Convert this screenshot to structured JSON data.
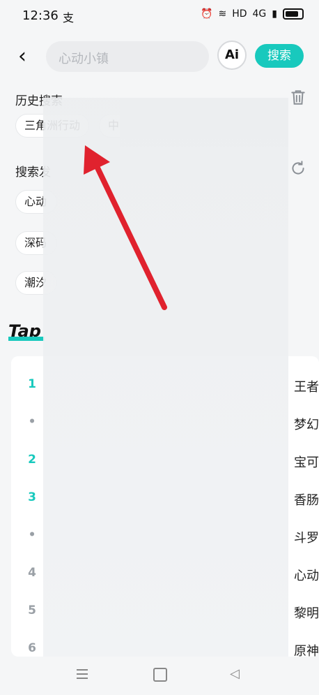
{
  "status_bar": {
    "time": "12:36",
    "app_icon_text": "支",
    "network": "HD",
    "signal": "4G"
  },
  "top_bar": {
    "back_icon": "back-icon",
    "search_placeholder": "心动小镇",
    "ai_label": "Ai",
    "search_button": "搜索"
  },
  "history": {
    "title": "历史搜索",
    "items": [
      "三角洲行动",
      "中"
    ]
  },
  "discover": {
    "title": "搜索发",
    "chips": [
      "心动",
      "深码",
      "潮汐"
    ]
  },
  "tap_section": {
    "logo": "Tap",
    "subtitle": ""
  },
  "ranking": {
    "rows": [
      {
        "rank": "1",
        "name": "王者",
        "accent": true
      },
      {
        "rank": "•",
        "name": "梦幻",
        "accent": false
      },
      {
        "rank": "2",
        "name": "宝可",
        "accent": true
      },
      {
        "rank": "3",
        "name": "香肠",
        "accent": true
      },
      {
        "rank": "•",
        "name": "斗罗",
        "accent": false
      },
      {
        "rank": "4",
        "name": "心动",
        "accent": false
      },
      {
        "rank": "5",
        "name": "黎明",
        "accent": false
      },
      {
        "rank": "6",
        "name": "原神",
        "accent": false
      }
    ]
  },
  "colors": {
    "accent": "#18c9bd",
    "arrow": "#e0222e",
    "muted": "#9aa0a6"
  }
}
